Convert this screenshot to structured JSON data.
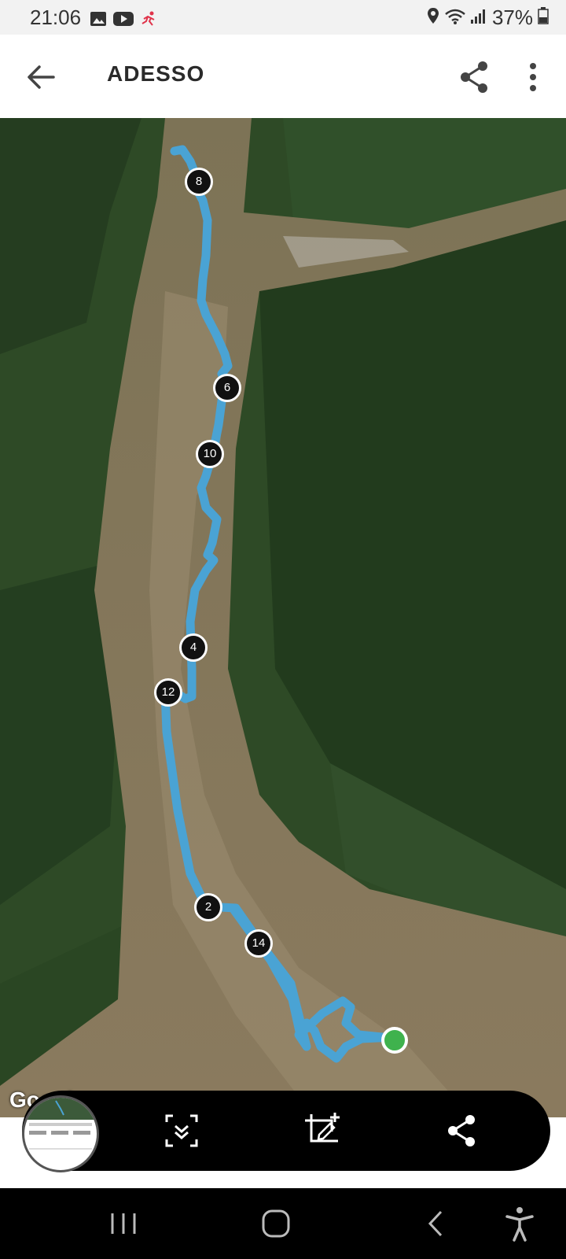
{
  "status_bar": {
    "time": "21:06",
    "battery": "37%",
    "left_icons": [
      "image-icon",
      "youtube-icon",
      "runner-icon"
    ],
    "right_icons": [
      "location-icon",
      "wifi-icon",
      "signal-icon",
      "battery-icon"
    ]
  },
  "app_bar": {
    "title": "ADESSO",
    "back_icon": "arrow-left-icon",
    "share_icon": "share-icon",
    "more_icon": "more-vertical-icon"
  },
  "map": {
    "attribution": "Google",
    "route_color": "#4aa3d4",
    "start_color": "#3fb24d",
    "km_markers": [
      {
        "label": "8"
      },
      {
        "label": "6"
      },
      {
        "label": "10"
      },
      {
        "label": "4"
      },
      {
        "label": "12"
      },
      {
        "label": "2"
      },
      {
        "label": "14"
      }
    ]
  },
  "bottom_toolbar": {
    "buttons": [
      {
        "name": "scroll-capture",
        "icon": "scroll-capture-icon"
      },
      {
        "name": "crop-edit",
        "icon": "crop-edit-icon"
      },
      {
        "name": "share",
        "icon": "share-icon"
      }
    ]
  },
  "nav_bar": {
    "buttons": [
      "recents-icon",
      "home-icon",
      "back-icon",
      "accessibility-icon"
    ]
  }
}
